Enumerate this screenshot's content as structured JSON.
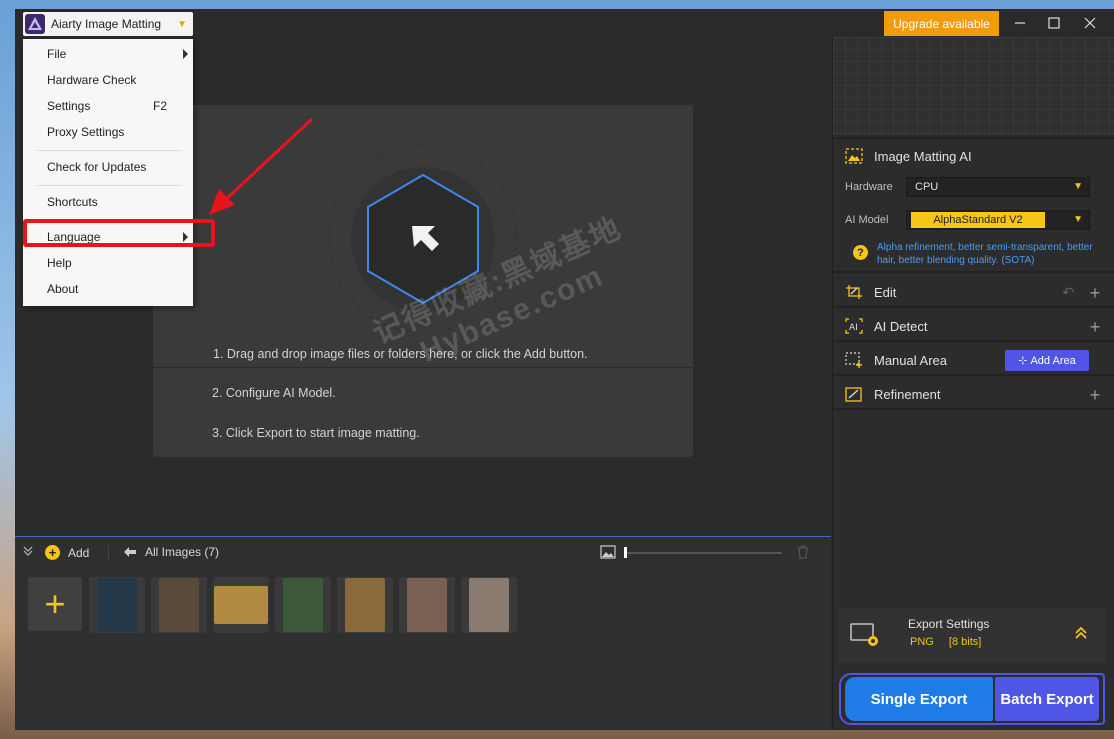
{
  "app": {
    "title": "Aiarty Image Matting",
    "upgrade_label": "Upgrade available"
  },
  "menu": {
    "items": [
      {
        "label": "File",
        "submenu": true
      },
      {
        "label": "Hardware Check"
      },
      {
        "label": "Settings",
        "shortcut": "F2"
      },
      {
        "label": "Proxy Settings"
      },
      {
        "label": "Check for Updates"
      },
      {
        "label": "Shortcuts"
      },
      {
        "label": "Language",
        "submenu": true
      },
      {
        "label": "Help"
      },
      {
        "label": "About"
      }
    ]
  },
  "canvas": {
    "steps": [
      "1. Drag and drop image files or folders here, or click the Add button.",
      "2. Configure AI Model.",
      "3. Click Export to start image matting."
    ],
    "watermark": "记得收藏:黑域基地 Hybase.com"
  },
  "strip": {
    "add_label": "Add",
    "all_images_label": "All Images (7)",
    "thumbnail_colors": [
      "#233848",
      "#5a4a3a",
      "#b08a40",
      "#3c5a3a",
      "#8a6a3a",
      "#7a6050",
      "#8a7a70"
    ]
  },
  "panel": {
    "matting": {
      "title": "Image Matting AI",
      "hardware_label": "Hardware",
      "hardware_value": "CPU",
      "model_label": "AI Model",
      "model_value": "AlphaStandard  V2",
      "description": "Alpha refinement, better semi-transparent, better hair, better blending quality. (SOTA)"
    },
    "edit_label": "Edit",
    "detect_label": "AI Detect",
    "manual_label": "Manual Area",
    "add_area_label": "Add Area",
    "refinement_label": "Refinement",
    "export": {
      "title": "Export Settings",
      "format": "PNG",
      "bits": "[8 bits]",
      "single_label": "Single Export",
      "batch_label": "Batch Export"
    }
  },
  "colors": {
    "accent_yellow": "#f5c518",
    "accent_blue": "#1f7ce6",
    "accent_purple": "#4f56e6",
    "upgrade_orange": "#f29b0c",
    "annotation_red": "#e8141c"
  }
}
